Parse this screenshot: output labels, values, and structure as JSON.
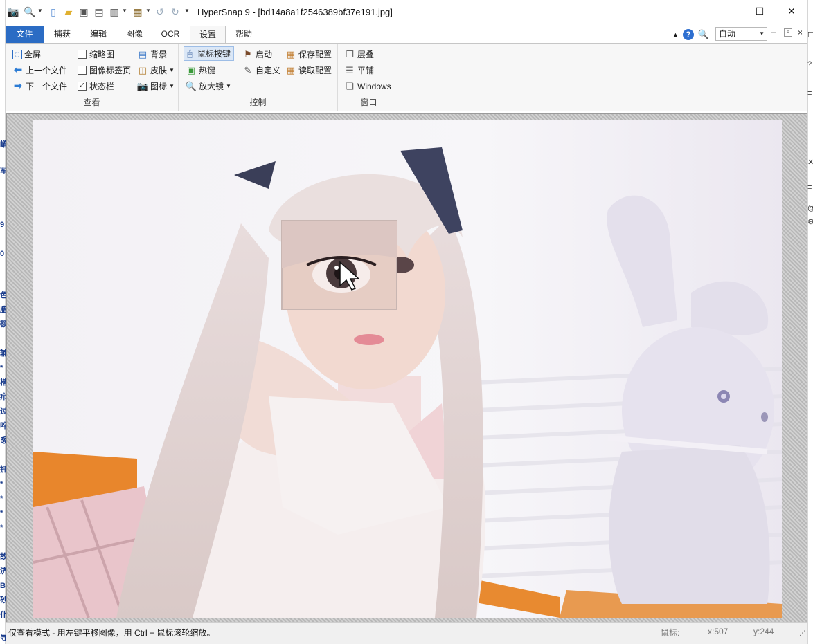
{
  "window": {
    "title": "HyperSnap 9 - [bd14a8a1f2546389bf37e191.jpg]",
    "controls": [
      "—",
      "☐",
      "✕"
    ]
  },
  "quick_access": [
    "camera-icon",
    "zoom-icon",
    "new-doc-icon",
    "open-folder-icon",
    "save-icon",
    "print-icon",
    "scan-icon",
    "paste-icon",
    "undo-icon",
    "redo-icon",
    "customize-icon"
  ],
  "tabs": [
    {
      "label": "文件"
    },
    {
      "label": "捕获"
    },
    {
      "label": "编辑"
    },
    {
      "label": "图像"
    },
    {
      "label": "OCR"
    },
    {
      "label": "设置"
    },
    {
      "label": "帮助"
    }
  ],
  "active_tab": "设置",
  "zoom": {
    "value": "自动"
  },
  "ribbon": {
    "view_group": {
      "label": "查看",
      "fullscreen": "全屏",
      "prev_file": "上一个文件",
      "next_file": "下一个文件",
      "thumbnail": {
        "label": "缩略图",
        "checked": false
      },
      "image_tabs": {
        "label": "图像标签页",
        "checked": false
      },
      "status_bar": {
        "label": "状态栏",
        "checked": true
      },
      "background": "背景",
      "skin": "皮肤",
      "icons": "图标"
    },
    "control_group": {
      "label": "控制",
      "mouse_buttons": "鼠标按键",
      "hotkeys": "热键",
      "magnifier": "放大镜",
      "startup": "启动",
      "customize": "自定义",
      "save_config": "保存配置",
      "load_config": "读取配置"
    },
    "window_group": {
      "label": "窗口",
      "cascade": "层叠",
      "tile": "平铺",
      "windows": "Windows"
    }
  },
  "status_bar": {
    "message": "仅查看模式 - 用左键平移图像，用 Ctrl + 鼠标滚轮缩放。",
    "mouse_label": "鼠标:",
    "x": "x:507",
    "y": "y:244"
  },
  "desktop_left_glyphs": [
    "嵴",
    "军",
    "9",
    "0",
    "色",
    "腊",
    "额",
    "辅",
    "*",
    "楷",
    "疖",
    "过",
    "啐",
    "豸",
    "拥",
    "*",
    "*",
    "*",
    "*",
    "故",
    "济",
    "B",
    "砂",
    "仆",
    "导rx"
  ],
  "desktop_right_glyphs": [
    "☐",
    "?",
    "≡",
    "✕",
    "≡",
    "@",
    "⚙"
  ],
  "colors": {
    "accent": "#2b6cc4",
    "ribbon_bg": "#f7f7f7"
  }
}
